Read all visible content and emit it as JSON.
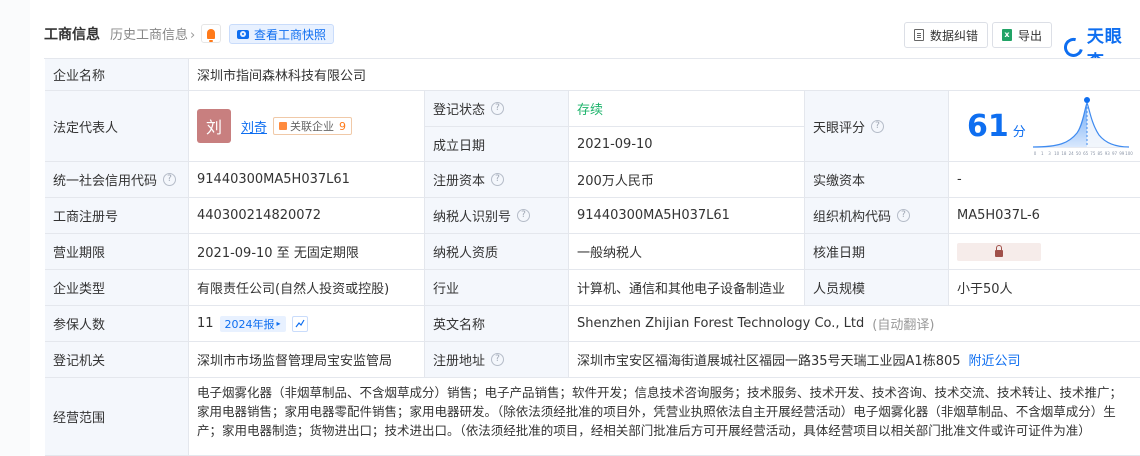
{
  "header": {
    "title": "工商信息",
    "history_label": "历史工商信息",
    "history_chevron": "›",
    "snapshot_label": "查看工商快照",
    "report_error_label": "数据纠错",
    "export_label": "导出",
    "logo_text": "天眼查"
  },
  "colors": {
    "accent": "#0e6ef0",
    "status_green": "#1db36b",
    "label_bg": "#f4f7fc",
    "tag_orange": "#ff7a1a"
  },
  "fields": {
    "company_name_label": "企业名称",
    "company_name": "深圳市指间森林科技有限公司",
    "legal_rep_label": "法定代表人",
    "legal_rep_avatar": "刘",
    "legal_rep_name": "刘奇",
    "related_label": "关联企业",
    "related_count": "9",
    "reg_status_label": "登记状态",
    "reg_status": "存续",
    "founded_label": "成立日期",
    "founded": "2021-09-10",
    "score_label": "天眼评分",
    "score": "61",
    "score_unit": "分",
    "credit_code_label": "统一社会信用代码",
    "credit_code": "91440300MA5H037L61",
    "reg_capital_label": "注册资本",
    "reg_capital": "200万人民币",
    "paid_capital_label": "实缴资本",
    "paid_capital": "-",
    "reg_no_label": "工商注册号",
    "reg_no": "440300214820072",
    "taxpayer_id_label": "纳税人识别号",
    "taxpayer_id": "91440300MA5H037L61",
    "org_code_label": "组织机构代码",
    "org_code": "MA5H037L-6",
    "term_label": "营业期限",
    "term": "2021-09-10 至 无固定期限",
    "taxpayer_type_label": "纳税人资质",
    "taxpayer_type": "一般纳税人",
    "approval_date_label": "核准日期",
    "company_type_label": "企业类型",
    "company_type": "有限责任公司(自然人投资或控股)",
    "industry_label": "行业",
    "industry": "计算机、通信和其他电子设备制造业",
    "staff_size_label": "人员规模",
    "staff_size": "小于50人",
    "insured_label": "参保人数",
    "insured": "11",
    "insured_year_tag": "2024年报",
    "english_name_label": "英文名称",
    "english_name": "Shenzhen Zhijian Forest Technology Co., Ltd",
    "auto_translate": "(自动翻译)",
    "authority_label": "登记机关",
    "authority": "深圳市市场监督管理局宝安监管局",
    "address_label": "注册地址",
    "address": "深圳市宝安区福海街道展城社区福园一路35号天瑞工业园A1栋805",
    "nearby_link": "附近公司",
    "scope_label": "经营范围",
    "scope": "电子烟雾化器（非烟草制品、不含烟草成分）销售；电子产品销售；软件开发；信息技术咨询服务；技术服务、技术开发、技术咨询、技术交流、技术转让、技术推广；家用电器销售；家用电器零配件销售；家用电器研发。（除依法须经批准的项目外，凭营业执照依法自主开展经营活动）电子烟雾化器（非烟草制品、不含烟草成分）生产；家用电器制造；货物进出口；技术进出口。（依法须经批准的项目，经相关部门批准后方可开展经营活动，具体经营项目以相关部门批准文件或许可证件为准）"
  },
  "score_chart": {
    "type": "area",
    "x_ticks": [
      "0",
      "1",
      "3",
      "10",
      "18",
      "24",
      "50",
      "65",
      "75",
      "85",
      "93",
      "97",
      "99",
      "100"
    ],
    "marker_value": 61
  }
}
